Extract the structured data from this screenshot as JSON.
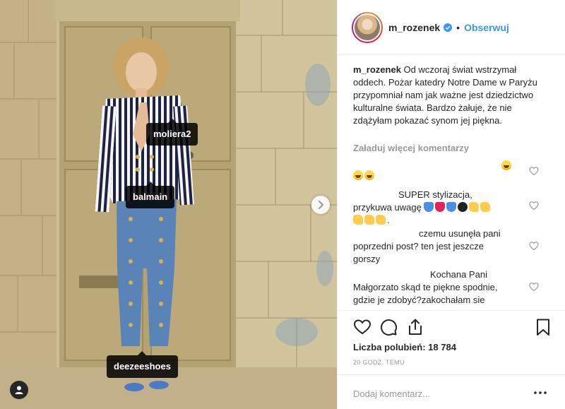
{
  "photo": {
    "tags": {
      "tag1": "moliera2",
      "tag2": "balmain",
      "tag3": "deezeeshoes"
    },
    "icons": {
      "user_tags": "person-icon",
      "next": "chevron-right-icon"
    }
  },
  "header": {
    "username": "m_rozenek",
    "verified_icon": "verified-badge-icon",
    "separator": "•",
    "follow_label": "Obserwuj"
  },
  "caption": {
    "username": "m_rozenek",
    "text": "Od wczoraj świat wstrzymał oddech. Pożar katedry Notre Dame w Paryżu przypomniał nam jak ważne jest dziedzictwo kulturalne świata. Bardzo żałuje, że nie zdążyłam pokazać synom jej piękna."
  },
  "load_more": "Załaduj więcej komentarzy",
  "comments": [
    {
      "text": "",
      "emojis": [
        "laugh",
        "laugh",
        "laugh"
      ]
    },
    {
      "line1": "SUPER stylizacja,",
      "line2": "przykuwa uwagę",
      "emojis": [
        "blue-heart",
        "red-heart",
        "blue-heart",
        "bomb",
        "clap",
        "clap",
        "clap",
        "clap",
        "clap"
      ]
    },
    {
      "line1": "czemu usunęła pani",
      "line2": "poprzedni post? ten jest jeszcze",
      "line3": "gorszy"
    },
    {
      "line1": "Kochana Pani",
      "line2": "Małgorzato skąd te piękne spodnie,",
      "line3": "gdzie je zdobyć?zakochałam sie"
    }
  ],
  "actions": {
    "like_icon": "heart-icon",
    "comment_icon": "comment-icon",
    "share_icon": "share-icon",
    "save_icon": "bookmark-icon"
  },
  "likes_text": "Liczba polubień: 18 784",
  "time_ago": "20 GODZ. TEMU",
  "add_comment": {
    "placeholder": "Dodaj komentarz...",
    "more_icon": "more-options-icon"
  },
  "colors": {
    "link_blue": "#3897f0",
    "muted_text": "#999999",
    "border": "#efefef"
  }
}
